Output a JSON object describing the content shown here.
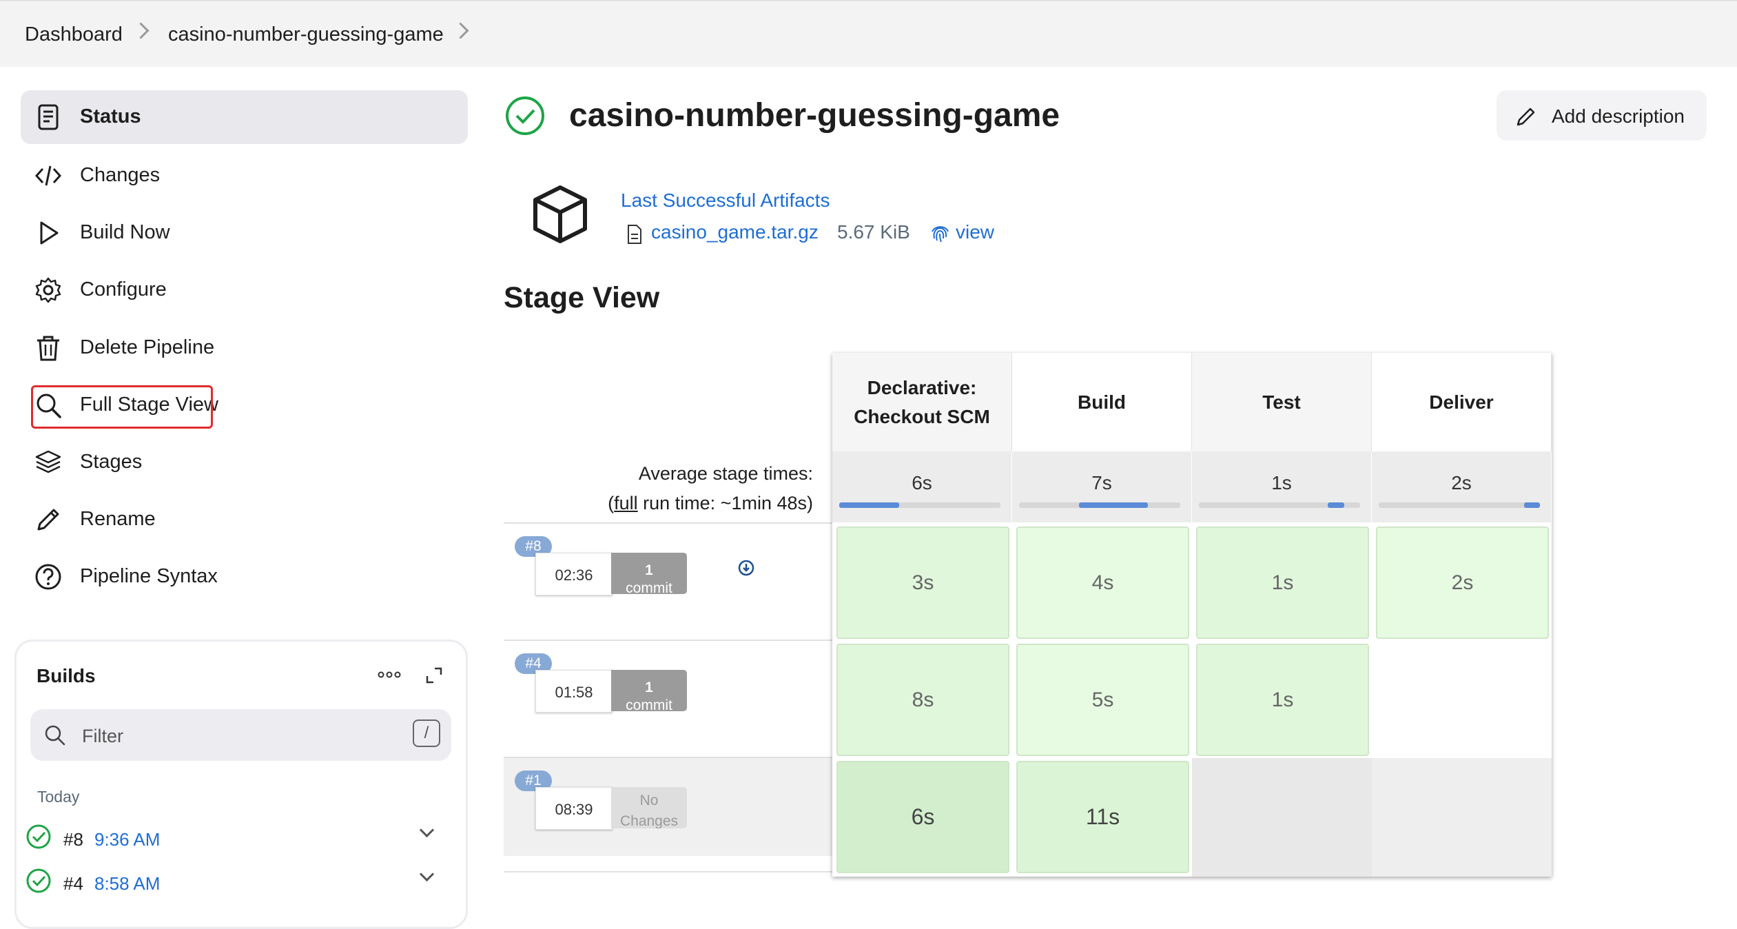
{
  "breadcrumb": {
    "items": [
      "Dashboard",
      "casino-number-guessing-game"
    ]
  },
  "sidebar": {
    "items": [
      {
        "label": "Status",
        "icon": "document-icon",
        "active": true
      },
      {
        "label": "Changes",
        "icon": "code-icon"
      },
      {
        "label": "Build Now",
        "icon": "play-icon"
      },
      {
        "label": "Configure",
        "icon": "gear-icon"
      },
      {
        "label": "Delete Pipeline",
        "icon": "trash-icon"
      },
      {
        "label": "Full Stage View",
        "icon": "search-icon",
        "highlighted": true
      },
      {
        "label": "Stages",
        "icon": "layers-icon"
      },
      {
        "label": "Rename",
        "icon": "pencil-icon"
      },
      {
        "label": "Pipeline Syntax",
        "icon": "help-icon"
      }
    ]
  },
  "builds": {
    "title": "Builds",
    "filter_placeholder": "Filter",
    "filter_shortcut": "/",
    "group_label": "Today",
    "items": [
      {
        "number": "#8",
        "time": "9:36 AM",
        "status": "success"
      },
      {
        "number": "#4",
        "time": "8:58 AM",
        "status": "success"
      }
    ]
  },
  "job": {
    "title": "casino-number-guessing-game",
    "add_description": "Add description",
    "artifacts_link": "Last Successful Artifacts",
    "artifact": {
      "name": "casino_game.tar.gz",
      "size": "5.67 KiB",
      "view": "view"
    }
  },
  "stage_view": {
    "title": "Stage View",
    "avg_label": "Average stage times:",
    "full_run_prefix": "(",
    "full_link": "full",
    "full_run_suffix": " run time: ~1min 48s)",
    "stages": [
      {
        "name": "Declarative: Checkout SCM",
        "avg": "6s",
        "bar_start": 0.0,
        "bar_end": 0.37
      },
      {
        "name": "Build",
        "avg": "7s",
        "bar_start": 0.37,
        "bar_end": 0.8
      },
      {
        "name": "Test",
        "avg": "1s",
        "bar_start": 0.8,
        "bar_end": 0.9
      },
      {
        "name": "Deliver",
        "avg": "2s",
        "bar_start": 0.9,
        "bar_end": 1.0
      }
    ],
    "runs": [
      {
        "badge": "#8",
        "time": "02:36",
        "changes": "1",
        "changes_sub": "commit",
        "cells": [
          "3s",
          "4s",
          "1s",
          "2s"
        ]
      },
      {
        "badge": "#4",
        "time": "01:58",
        "changes": "1",
        "changes_sub": "commit",
        "cells": [
          "8s",
          "5s",
          "1s",
          ""
        ]
      },
      {
        "badge": "#1",
        "time": "08:39",
        "changes": "No",
        "changes_sub": "Changes",
        "cells": [
          "6s",
          "11s",
          "",
          ""
        ]
      }
    ]
  },
  "colors": {
    "success_green": "#1ea446",
    "link_blue": "#1e6ed4",
    "highlight_red": "#e02b2b"
  }
}
